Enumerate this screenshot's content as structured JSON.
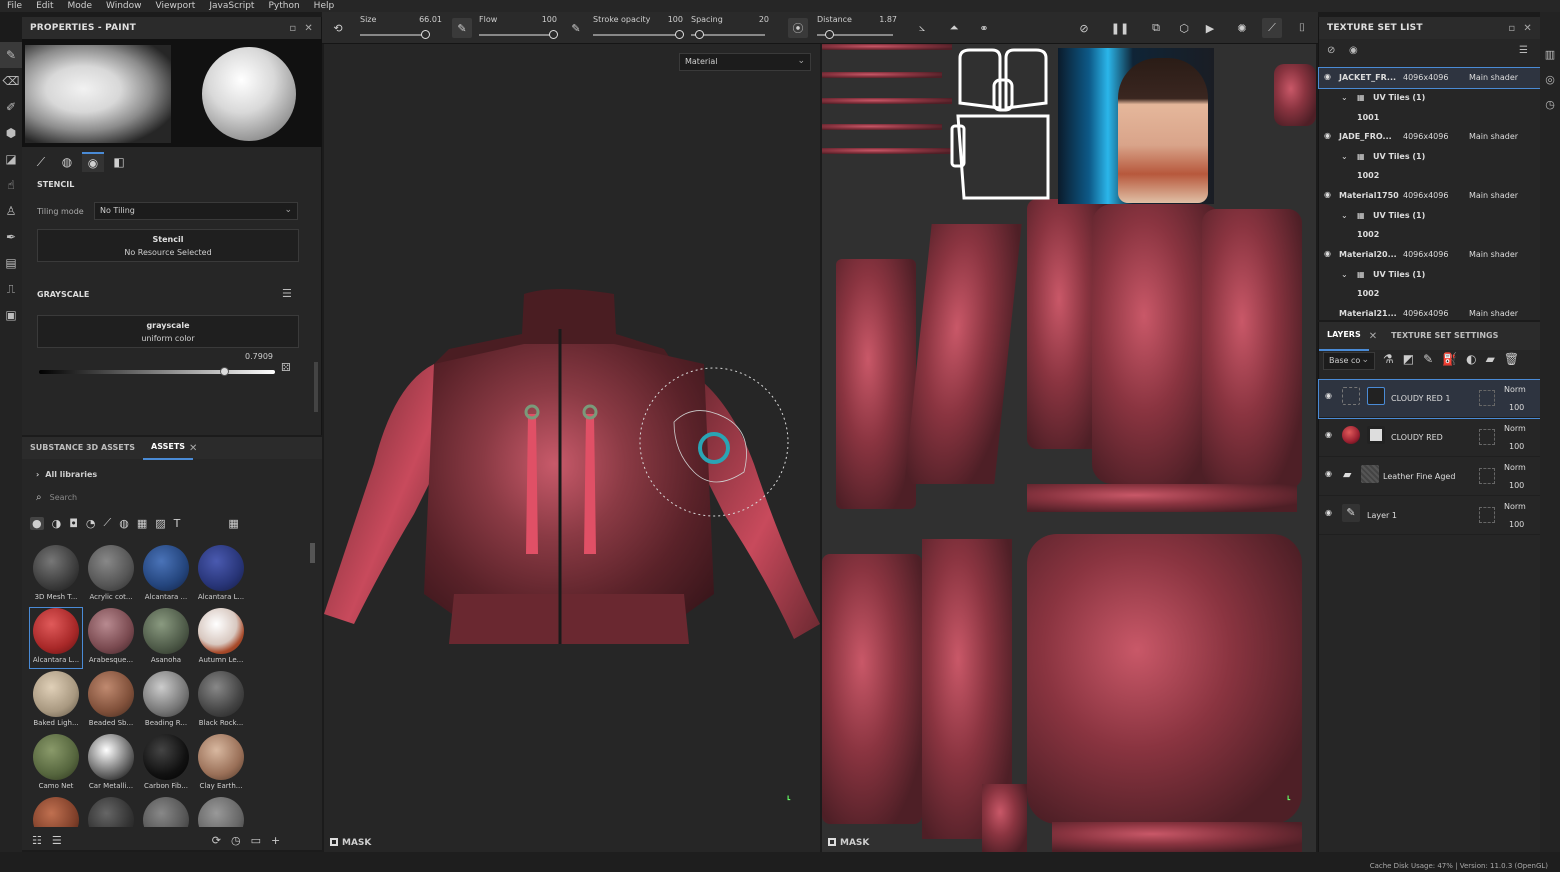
{
  "menubar": [
    "File",
    "Edit",
    "Mode",
    "Window",
    "Viewport",
    "JavaScript",
    "Python",
    "Help"
  ],
  "properties": {
    "title": "PROPERTIES - PAINT",
    "stencil_label": "STENCIL",
    "tiling_label": "Tiling mode",
    "tiling_value": "No Tiling",
    "stencil_title": "Stencil",
    "stencil_sub": "No Resource Selected",
    "grayscale_label": "GRAYSCALE",
    "grayscale_title": "grayscale",
    "grayscale_sub": "uniform color",
    "grayscale_value": "0.7909"
  },
  "assets": {
    "tab1": "SUBSTANCE 3D ASSETS",
    "tab2": "ASSETS",
    "all_libraries": "All libraries",
    "search_placeholder": "Search",
    "items": [
      {
        "label": "3D Mesh T..."
      },
      {
        "label": "Acrylic cot..."
      },
      {
        "label": "Alcantara ..."
      },
      {
        "label": "Alcantara L..."
      },
      {
        "label": "Alcantara L..."
      },
      {
        "label": "Arabesque..."
      },
      {
        "label": "Asanoha"
      },
      {
        "label": "Autumn Le..."
      },
      {
        "label": "Baked Ligh..."
      },
      {
        "label": "Beaded Sb..."
      },
      {
        "label": "Beading R..."
      },
      {
        "label": "Black Rock..."
      },
      {
        "label": "Camo Net"
      },
      {
        "label": "Car Metalli..."
      },
      {
        "label": "Carbon Fib..."
      },
      {
        "label": "Clay Earth..."
      },
      {
        "label": ""
      },
      {
        "label": ""
      },
      {
        "label": ""
      },
      {
        "label": ""
      }
    ]
  },
  "toolbar": {
    "size_label": "Size",
    "size_value": "66.01",
    "flow_label": "Flow",
    "flow_value": "100",
    "stroke_label": "Stroke opacity",
    "stroke_value": "100",
    "spacing_label": "Spacing",
    "spacing_value": "20",
    "distance_label": "Distance",
    "distance_value": "1.87"
  },
  "viewport3d": {
    "channel": "Material",
    "mask": "MASK"
  },
  "viewport2d": {
    "mask": "MASK"
  },
  "texture_set_list": {
    "title": "TEXTURE SET LIST",
    "sets": [
      {
        "name": "JACKET_FR...",
        "res": "4096x4096",
        "shader": "Main shader",
        "uv": "UV Tiles (1)",
        "tile": "1001"
      },
      {
        "name": "JADE_FRO...",
        "res": "4096x4096",
        "shader": "Main shader",
        "uv": "UV Tiles (1)",
        "tile": "1002"
      },
      {
        "name": "Material1750",
        "res": "4096x4096",
        "shader": "Main shader",
        "uv": "UV Tiles (1)",
        "tile": "1002"
      },
      {
        "name": "Material20...",
        "res": "4096x4096",
        "shader": "Main shader",
        "uv": "UV Tiles (1)",
        "tile": "1002"
      },
      {
        "name": "Material21...",
        "res": "4096x4096",
        "shader": "Main shader"
      }
    ]
  },
  "layers": {
    "tab1": "LAYERS",
    "tab2": "TEXTURE SET SETTINGS",
    "channel": "Base co",
    "rows": [
      {
        "name": "CLOUDY RED 1",
        "blend": "Norm",
        "opacity": "100"
      },
      {
        "name": "CLOUDY RED",
        "blend": "Norm",
        "opacity": "100"
      },
      {
        "name": "Leather Fine Aged",
        "blend": "Norm",
        "opacity": "100"
      },
      {
        "name": "Layer 1",
        "blend": "Norm",
        "opacity": "100"
      }
    ]
  },
  "status": "Cache Disk Usage:  47% | Version: 11.0.3 (OpenGL)",
  "colors": {
    "accent": "#4a8bd6",
    "leather": "#8a3440",
    "tassel": "#e05066"
  }
}
